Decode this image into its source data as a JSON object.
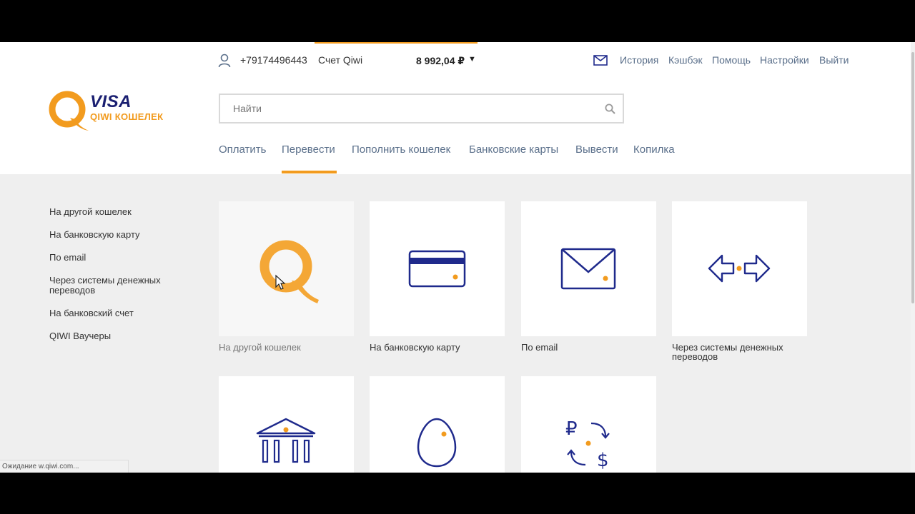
{
  "header": {
    "phone": "+79174496443",
    "account_label": "Счет Qiwi",
    "balance": "8 992,04 ₽",
    "links": [
      "История",
      "Кэшбэк",
      "Помощь",
      "Настройки",
      "Выйти"
    ]
  },
  "logo": {
    "visa": "VISA",
    "subtitle": "QIWI КОШЕЛЕК"
  },
  "search": {
    "placeholder": "Найти"
  },
  "nav": {
    "tabs": [
      "Оплатить",
      "Перевести",
      "Пополнить кошелек",
      "Банковские карты",
      "Вывести",
      "Копилка"
    ],
    "active": "Перевести"
  },
  "sidebar": {
    "items": [
      "На другой кошелек",
      "На банковскую карту",
      "По email",
      "Через системы денежных переводов",
      "На банковский счет",
      "QIWI Ваучеры"
    ]
  },
  "cards": [
    {
      "label": "На другой кошелек",
      "icon": "qiwi-logo-icon"
    },
    {
      "label": "На банковскую карту",
      "icon": "bank-card-icon"
    },
    {
      "label": "По email",
      "icon": "envelope-icon"
    },
    {
      "label": "Через системы денежных переводов",
      "icon": "transfer-arrows-icon"
    },
    {
      "label": "",
      "icon": "bank-building-icon"
    },
    {
      "label": "",
      "icon": "egg-icon"
    },
    {
      "label": "",
      "icon": "currency-exchange-icon"
    }
  ],
  "status": {
    "text": "Ожидание w.qiwi.com..."
  },
  "colors": {
    "accent": "#f29b1e",
    "icon": "#1f2a8c",
    "link": "#5a6f8a"
  }
}
